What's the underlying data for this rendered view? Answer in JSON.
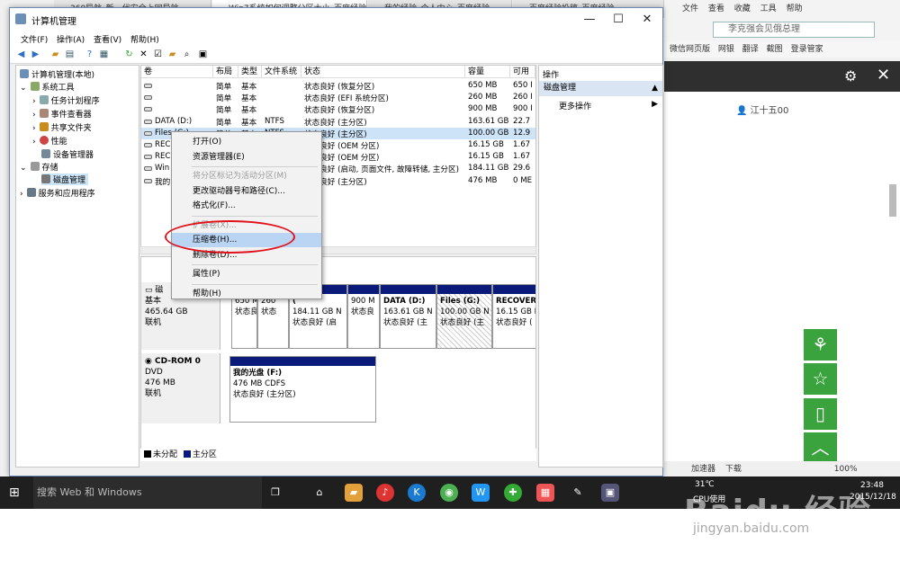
{
  "browser": {
    "tabs": [
      "360导航_新一代安全上网导航",
      "Win7系统如何调整分区大小_百度经验",
      "我的经验_个人中心_百度经验",
      "百度经验投稿_百度经验"
    ],
    "menu": [
      "文件",
      "查看",
      "收藏",
      "工具",
      "帮助"
    ],
    "search_placeholder": "李克强会见俄总理",
    "favorites": [
      "微信网页版",
      "网银",
      "翻译",
      "截图",
      "登录管家"
    ],
    "user_name": "江十五00",
    "sidebar_icons": [
      "share-icon",
      "star-icon",
      "bookmark-icon",
      "up-arrow-icon"
    ],
    "status": [
      "加速器",
      "下载",
      "100%"
    ]
  },
  "window": {
    "title": "计算机管理",
    "menu": [
      "文件(F)",
      "操作(A)",
      "查看(V)",
      "帮助(H)"
    ]
  },
  "tree": [
    {
      "label": "计算机管理(本地)",
      "level": 0
    },
    {
      "label": "系统工具",
      "level": 1
    },
    {
      "label": "任务计划程序",
      "level": 2
    },
    {
      "label": "事件查看器",
      "level": 2
    },
    {
      "label": "共享文件夹",
      "level": 2
    },
    {
      "label": "性能",
      "level": 2
    },
    {
      "label": "设备管理器",
      "level": 2
    },
    {
      "label": "存储",
      "level": 1
    },
    {
      "label": "磁盘管理",
      "level": 2
    },
    {
      "label": "服务和应用程序",
      "level": 1
    }
  ],
  "volumes": {
    "headers": [
      "卷",
      "布局",
      "类型",
      "文件系统",
      "状态",
      "容量",
      "可用"
    ],
    "rows": [
      [
        "",
        "简单",
        "基本",
        "",
        "状态良好 (恢复分区)",
        "650 MB",
        "650 I"
      ],
      [
        "",
        "简单",
        "基本",
        "",
        "状态良好 (EFI 系统分区)",
        "260 MB",
        "260 I"
      ],
      [
        "",
        "简单",
        "基本",
        "",
        "状态良好 (恢复分区)",
        "900 MB",
        "900 I"
      ],
      [
        "DATA (D:)",
        "简单",
        "基本",
        "NTFS",
        "状态良好 (主分区)",
        "163.61 GB",
        "22.7"
      ],
      [
        "Files (G:)",
        "简单",
        "基本",
        "NTFS",
        "状态良好 (主分区)",
        "100.00 GB",
        "12.9"
      ],
      [
        "REC",
        "",
        "",
        "",
        "状态良好 (OEM 分区)",
        "16.15 GB",
        "1.67"
      ],
      [
        "REC",
        "",
        "",
        "",
        "状态良好 (OEM 分区)",
        "16.15 GB",
        "1.67"
      ],
      [
        "Win",
        "",
        "",
        "",
        "状态良好 (启动, 页面文件, 故障转储, 主分区)",
        "184.11 GB",
        "29.6"
      ],
      [
        "我的",
        "",
        "",
        "",
        "状态良好 (主分区)",
        "476 MB",
        "0 ME"
      ]
    ]
  },
  "disk0": {
    "label": "磁",
    "type": "基本",
    "size": "465.64 GB",
    "status": "联机",
    "partitions": [
      {
        "name": "",
        "size": "650 M",
        "status": "状态良"
      },
      {
        "name": "",
        "size": "260",
        "status": "状态"
      },
      {
        "name": "(",
        "size": "184.11 GB N",
        "status": "状态良好 (启"
      },
      {
        "name": "",
        "size": "900 M",
        "status": "状态良"
      },
      {
        "name": "DATA (D:)",
        "size": "163.61 GB N",
        "status": "状态良好 (主"
      },
      {
        "name": "Files (G:)",
        "size": "100.00 GB N",
        "status": "状态良好 (主"
      },
      {
        "name": "RECOVER",
        "size": "16.15 GB N",
        "status": "状态良好 ("
      }
    ]
  },
  "cdrom": {
    "label": "CD-ROM 0",
    "type": "DVD",
    "size": "476 MB",
    "status": "联机",
    "partition": {
      "name": "我的光盘 (F:)",
      "size": "476 MB CDFS",
      "status": "状态良好 (主分区)"
    }
  },
  "legend": [
    "未分配",
    "主分区"
  ],
  "actions": {
    "title": "操作",
    "section": "磁盘管理",
    "more": "更多操作"
  },
  "context_menu": [
    {
      "label": "打开(O)",
      "disabled": false
    },
    {
      "label": "资源管理器(E)",
      "disabled": false
    },
    {
      "sep": true
    },
    {
      "label": "将分区标记为活动分区(M)",
      "disabled": true
    },
    {
      "label": "更改驱动器号和路径(C)...",
      "disabled": false
    },
    {
      "label": "格式化(F)...",
      "disabled": false
    },
    {
      "sep": true
    },
    {
      "label": "扩展卷(X)...",
      "disabled": true
    },
    {
      "label": "压缩卷(H)...",
      "disabled": false,
      "highlight": true
    },
    {
      "label": "删除卷(D)...",
      "disabled": false
    },
    {
      "sep": true
    },
    {
      "label": "属性(P)",
      "disabled": false
    },
    {
      "sep": true
    },
    {
      "label": "帮助(H)",
      "disabled": false
    }
  ],
  "taskbar": {
    "search": "搜索 Web 和 Windows",
    "temp": "31℃",
    "cpu": "CPU使用",
    "time": "23:48",
    "date": "2015/12/18"
  },
  "watermark": {
    "main": "Baidu 经验",
    "sub": "jingyan.baidu.com"
  },
  "colors": {
    "highlight": "#b9d5f3",
    "partition_bar": "#0a1a7a",
    "annotation": "#e0121c",
    "sidebar_green": "#3aa33d"
  }
}
